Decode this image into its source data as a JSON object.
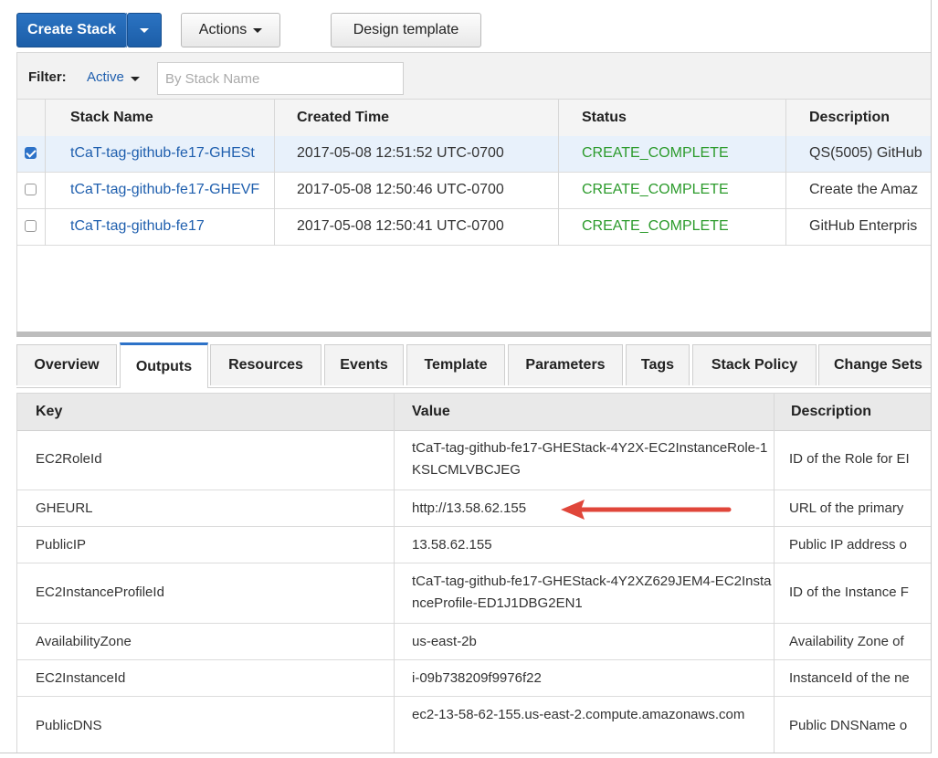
{
  "toolbar": {
    "create_stack": "Create Stack",
    "actions": "Actions",
    "design_template": "Design template"
  },
  "filter": {
    "label": "Filter:",
    "active": "Active",
    "placeholder": "By Stack Name"
  },
  "stacks": {
    "headers": {
      "name": "Stack Name",
      "created": "Created Time",
      "status": "Status",
      "description": "Description"
    },
    "rows": [
      {
        "name": "tCaT-tag-github-fe17-GHESt",
        "created": "2017-05-08 12:51:52 UTC-0700",
        "status": "CREATE_COMPLETE",
        "description": "QS(5005) GitHub",
        "checked": true
      },
      {
        "name": "tCaT-tag-github-fe17-GHEVF",
        "created": "2017-05-08 12:50:46 UTC-0700",
        "status": "CREATE_COMPLETE",
        "description": "Create the Amaz",
        "checked": false
      },
      {
        "name": "tCaT-tag-github-fe17",
        "created": "2017-05-08 12:50:41 UTC-0700",
        "status": "CREATE_COMPLETE",
        "description": "GitHub Enterpris",
        "checked": false
      }
    ]
  },
  "tabs": [
    "Overview",
    "Outputs",
    "Resources",
    "Events",
    "Template",
    "Parameters",
    "Tags",
    "Stack Policy",
    "Change Sets"
  ],
  "active_tab": "Outputs",
  "outputs": {
    "headers": {
      "key": "Key",
      "value": "Value",
      "description": "Description"
    },
    "rows": [
      {
        "key": "EC2RoleId",
        "value": "tCaT-tag-github-fe17-GHEStack-4Y2X-EC2InstanceRole-1KSLCMLVBCJEG",
        "description": "ID of the Role for EI"
      },
      {
        "key": "GHEURL",
        "value": "http://13.58.62.155",
        "description": "URL of the primary"
      },
      {
        "key": "PublicIP",
        "value": "13.58.62.155",
        "description": "Public IP address o"
      },
      {
        "key": "EC2InstanceProfileId",
        "value": "tCaT-tag-github-fe17-GHEStack-4Y2XZ629JEM4-EC2InstanceProfile-ED1J1DBG2EN1",
        "description": "ID of the Instance F"
      },
      {
        "key": "AvailabilityZone",
        "value": "us-east-2b",
        "description": "Availability Zone of"
      },
      {
        "key": "EC2InstanceId",
        "value": "i-09b738209f9976f22",
        "description": "InstanceId of the ne"
      },
      {
        "key": "PublicDNS",
        "value": "ec2-13-58-62-155.us-east-2.compute.amazonaws.com",
        "description": "Public DNSName o"
      }
    ]
  },
  "colors": {
    "primary": "#1f5fae",
    "status_ok": "#2c9b2c",
    "arrow": "#e0463a"
  }
}
